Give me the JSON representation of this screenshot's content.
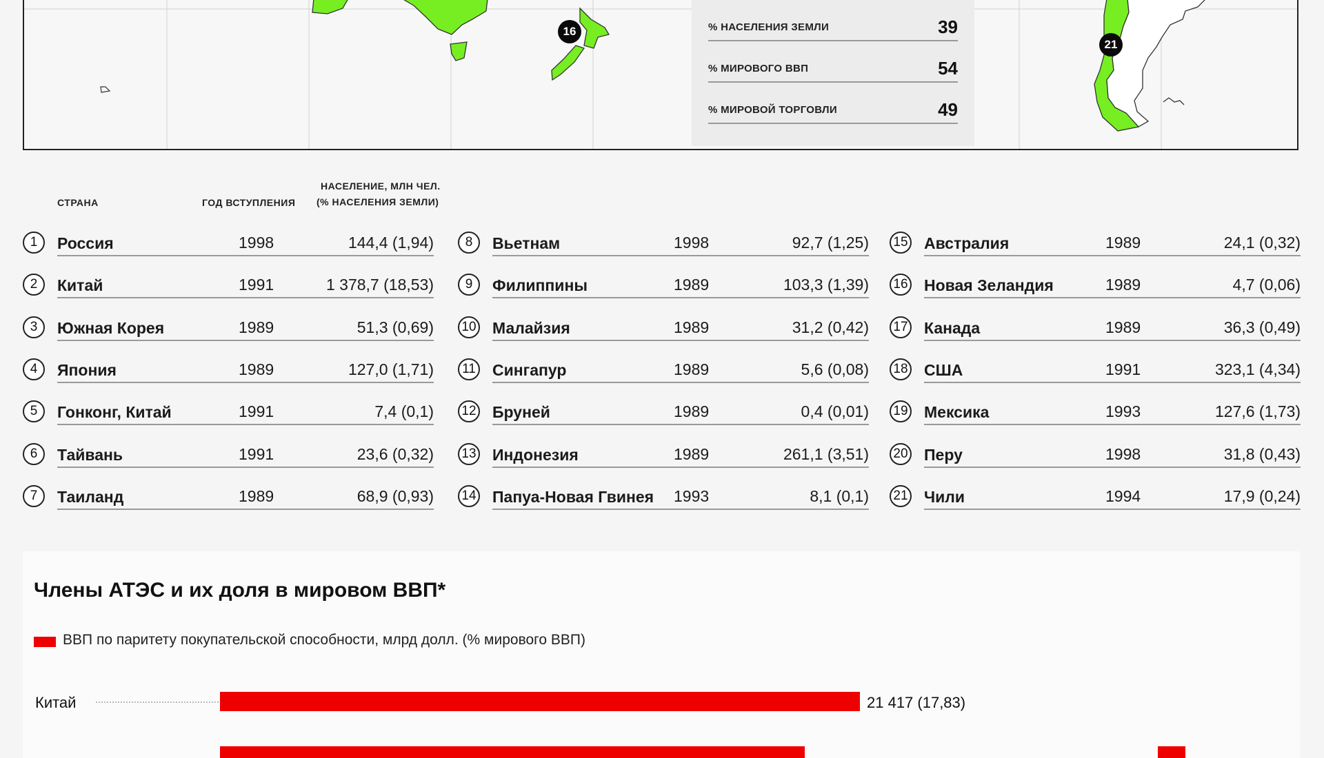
{
  "stats": [
    {
      "label": "% НАСЕЛЕНИЯ ЗЕМЛИ",
      "value": "39"
    },
    {
      "label": "% МИРОВОГО ВВП",
      "value": "54"
    },
    {
      "label": "% МИРОВОЙ ТОРГОВЛИ",
      "value": "49"
    }
  ],
  "map_markers": [
    "16",
    "21"
  ],
  "table": {
    "headers": {
      "country": "СТРАНА",
      "year": "ГОД ВСТУПЛЕНИЯ",
      "population_line1": "НАСЕЛЕНИЕ, МЛН ЧЕЛ.",
      "population_line2": "(% НАСЕЛЕНИЯ ЗЕМЛИ)"
    },
    "columns": [
      [
        {
          "n": "1",
          "country": "Россия",
          "year": "1998",
          "pop": "144,4 (1,94)"
        },
        {
          "n": "2",
          "country": "Китай",
          "year": "1991",
          "pop": "1 378,7 (18,53)"
        },
        {
          "n": "3",
          "country": "Южная Корея",
          "year": "1989",
          "pop": "51,3 (0,69)"
        },
        {
          "n": "4",
          "country": "Япония",
          "year": "1989",
          "pop": "127,0 (1,71)"
        },
        {
          "n": "5",
          "country": "Гонконг, Китай",
          "year": "1991",
          "pop": "7,4 (0,1)"
        },
        {
          "n": "6",
          "country": "Тайвань",
          "year": "1991",
          "pop": "23,6 (0,32)"
        },
        {
          "n": "7",
          "country": "Таиланд",
          "year": "1989",
          "pop": "68,9 (0,93)"
        }
      ],
      [
        {
          "n": "8",
          "country": "Вьетнам",
          "year": "1998",
          "pop": "92,7 (1,25)"
        },
        {
          "n": "9",
          "country": "Филиппины",
          "year": "1989",
          "pop": "103,3 (1,39)"
        },
        {
          "n": "10",
          "country": "Малайзия",
          "year": "1989",
          "pop": "31,2 (0,42)"
        },
        {
          "n": "11",
          "country": "Сингапур",
          "year": "1989",
          "pop": "5,6 (0,08)"
        },
        {
          "n": "12",
          "country": "Бруней",
          "year": "1989",
          "pop": "0,4 (0,01)"
        },
        {
          "n": "13",
          "country": "Индонезия",
          "year": "1989",
          "pop": "261,1 (3,51)"
        },
        {
          "n": "14",
          "country": "Папуа-Новая Гвинея",
          "year": "1993",
          "pop": "8,1 (0,1)"
        }
      ],
      [
        {
          "n": "15",
          "country": "Австралия",
          "year": "1989",
          "pop": "24,1 (0,32)"
        },
        {
          "n": "16",
          "country": "Новая Зеландия",
          "year": "1989",
          "pop": "4,7 (0,06)"
        },
        {
          "n": "17",
          "country": "Канада",
          "year": "1989",
          "pop": "36,3 (0,49)"
        },
        {
          "n": "18",
          "country": "США",
          "year": "1991",
          "pop": "323,1 (4,34)"
        },
        {
          "n": "19",
          "country": "Мексика",
          "year": "1993",
          "pop": "127,6 (1,73)"
        },
        {
          "n": "20",
          "country": "Перу",
          "year": "1998",
          "pop": "31,8 (0,43)"
        },
        {
          "n": "21",
          "country": "Чили",
          "year": "1994",
          "pop": "17,9 (0,24)"
        }
      ]
    ]
  },
  "chart": {
    "title": "Члены АТЭС и их доля в мировом ВВП*",
    "legend": "ВВП по паритету покупательской способности, млрд долл. (% мирового ВВП)"
  },
  "chart_data": {
    "type": "bar",
    "orientation": "horizontal",
    "categories": [
      "Китай"
    ],
    "values": [
      21417
    ],
    "value_labels": [
      "21 417 (17,83)"
    ],
    "share_percent": [
      17.83
    ],
    "color": "#ee0000"
  },
  "colors": {
    "land_highlight": "#77ee22",
    "bar": "#ee0000",
    "marker": "#0a0a0a"
  }
}
